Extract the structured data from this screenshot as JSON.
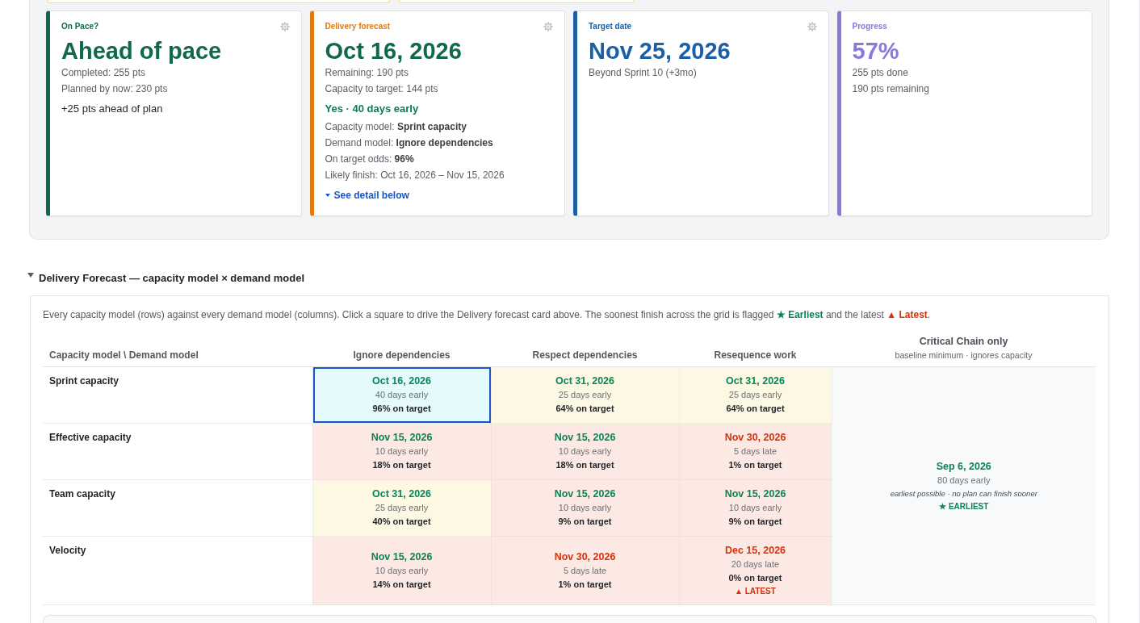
{
  "summary_cards": [
    {
      "label": "On Pace?",
      "color": "#10694f",
      "settings": true,
      "value": {
        "text": "Ahead of pace",
        "color": "#10694f"
      },
      "rows": [
        {
          "kind": "stat",
          "text": "Completed: 255 pts"
        },
        {
          "kind": "stat",
          "text": "Planned by now: 230 pts"
        },
        {
          "kind": "note",
          "text": "+25 pts ahead of plan"
        }
      ]
    },
    {
      "label": "Delivery forecast",
      "color": "#e07b12",
      "settings": true,
      "value": {
        "text": "Oct 16, 2026",
        "color": "#10694f"
      },
      "rows": [
        {
          "kind": "stat",
          "text": "Remaining: 190 pts"
        },
        {
          "kind": "stat",
          "text": "Capacity to target: 144 pts"
        },
        {
          "kind": "verdict",
          "text": "Yes · 40 days early"
        },
        {
          "kind": "detail",
          "text": "Capacity model: **Sprint capacity**"
        },
        {
          "kind": "detail",
          "text": "Demand model: **Ignore dependencies**"
        },
        {
          "kind": "detail",
          "text": "On target odds: **96%**"
        },
        {
          "kind": "detail",
          "text": "Likely finish: Oct 16, 2026 – Nov 15, 2026"
        },
        {
          "kind": "link",
          "text": "See detail below"
        }
      ]
    },
    {
      "label": "Target date",
      "color": "#1c5fa5",
      "settings": true,
      "value": {
        "text": "Nov 25, 2026",
        "color": "#1c5fa5"
      },
      "rows": [
        {
          "kind": "stat",
          "text": "Beyond Sprint 10 (+3mo)"
        }
      ]
    },
    {
      "label": "Progress",
      "color": "#8a78dc",
      "settings": false,
      "value": {
        "text": "57%",
        "color": "#8a78dc"
      },
      "rows": [
        {
          "kind": "stat",
          "text": "255 pts done"
        },
        {
          "kind": "stat",
          "text": "190 pts remaining"
        }
      ]
    }
  ],
  "forecast": {
    "title": "Delivery Forecast — capacity model × demand model",
    "expanded": true,
    "description": [
      {
        "kind": "text",
        "text": "Every capacity model (rows) against every demand model (columns). Click a square to drive the Delivery forecast card above. The soonest finish across the grid is flagged "
      },
      {
        "kind": "earliest",
        "text": "★ Earliest"
      },
      {
        "kind": "text",
        "text": " and the latest "
      },
      {
        "kind": "latest",
        "text": "▲ Latest"
      },
      {
        "kind": "text",
        "text": "."
      }
    ],
    "corner_label": "Capacity model \\ Demand model",
    "columns": [
      {
        "label": "Ignore dependencies"
      },
      {
        "label": "Respect dependencies"
      },
      {
        "label": "Resequence work"
      },
      {
        "label": "Critical Chain only",
        "sublabel": "baseline minimum · ignores capacity"
      }
    ],
    "rows": [
      {
        "label": "Sprint capacity",
        "cells": [
          {
            "date": "Oct 16, 2026",
            "offset": "40 days early",
            "odds": "96% on target",
            "late": false,
            "color": "#e4fafd",
            "selected": true
          },
          {
            "date": "Oct 31, 2026",
            "offset": "25 days early",
            "odds": "64% on target",
            "late": false,
            "color": "#fdf8e4",
            "selected": false
          },
          {
            "date": "Oct 31, 2026",
            "offset": "25 days early",
            "odds": "64% on target",
            "late": false,
            "color": "#fdf8e4",
            "selected": false
          }
        ]
      },
      {
        "label": "Effective capacity",
        "cells": [
          {
            "date": "Nov 15, 2026",
            "offset": "10 days early",
            "odds": "18% on target",
            "late": false,
            "color": "#fde9e3",
            "selected": false
          },
          {
            "date": "Nov 15, 2026",
            "offset": "10 days early",
            "odds": "18% on target",
            "late": false,
            "color": "#fde9e3",
            "selected": false
          },
          {
            "date": "Nov 30, 2026",
            "offset": "5 days late",
            "odds": "1% on target",
            "late": true,
            "color": "#fde9e3",
            "selected": false
          }
        ]
      },
      {
        "label": "Team capacity",
        "cells": [
          {
            "date": "Oct 31, 2026",
            "offset": "25 days early",
            "odds": "40% on target",
            "late": false,
            "color": "#fdf8e4",
            "selected": false
          },
          {
            "date": "Nov 15, 2026",
            "offset": "10 days early",
            "odds": "9% on target",
            "late": false,
            "color": "#fde9e3",
            "selected": false
          },
          {
            "date": "Nov 15, 2026",
            "offset": "10 days early",
            "odds": "9% on target",
            "late": false,
            "color": "#fde9e3",
            "selected": false
          }
        ]
      },
      {
        "label": "Velocity",
        "cells": [
          {
            "date": "Nov 15, 2026",
            "offset": "10 days early",
            "odds": "14% on target",
            "late": false,
            "color": "#fde9e3",
            "selected": false
          },
          {
            "date": "Nov 30, 2026",
            "offset": "5 days late",
            "odds": "1% on target",
            "late": true,
            "color": "#fde9e3",
            "selected": false
          },
          {
            "date": "Dec 15, 2026",
            "offset": "20 days late",
            "odds": "0% on target",
            "late": true,
            "color": "#fde9e3",
            "selected": false,
            "flag": {
              "kind": "latest",
              "text": "▲ LATEST"
            }
          }
        ]
      }
    ],
    "critical_chain": {
      "date": "Sep 6, 2026",
      "offset": "80 days early",
      "note": "earliest possible · no plan can finish sooner",
      "late": false,
      "color": "#f8f9fb",
      "flag": {
        "kind": "earliest",
        "text": "★ EARLIEST"
      }
    }
  }
}
